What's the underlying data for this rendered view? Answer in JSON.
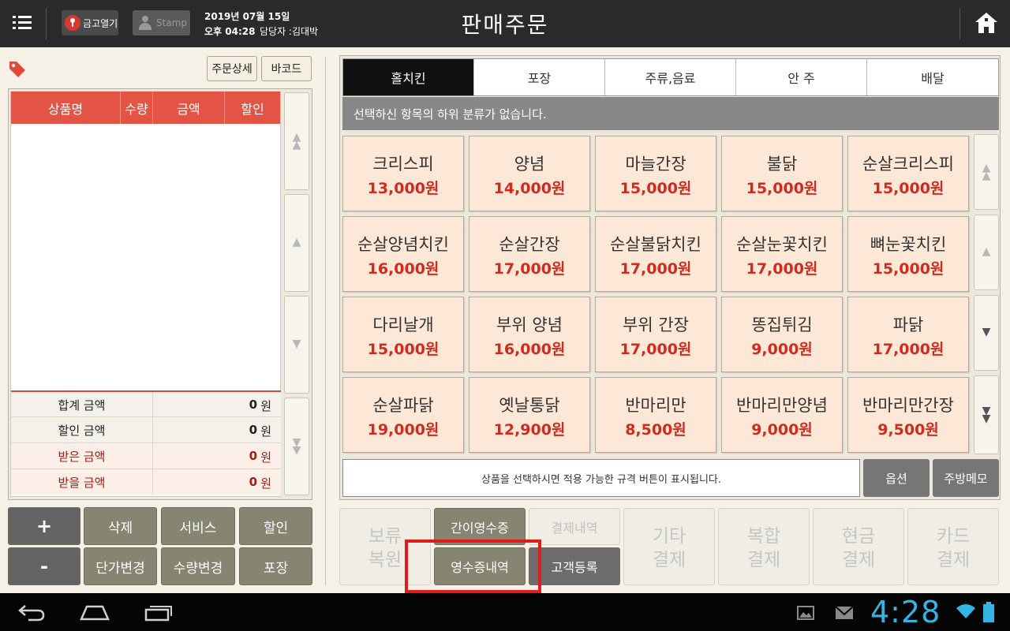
{
  "header": {
    "safe_label": "금고열기",
    "stamp_label": "Stamp",
    "date": "2019년 07월 15일",
    "time": "오후 04:28",
    "staff": "담당자 :김대박",
    "title": "판매주문"
  },
  "order_panel": {
    "detail_button": "주문상세",
    "barcode_button": "바코드",
    "columns": [
      "상품명",
      "수량",
      "금액",
      "할인"
    ],
    "summary": [
      {
        "label": "합계 금액",
        "value": "0",
        "unit": "원"
      },
      {
        "label": "할인 금액",
        "value": "0",
        "unit": "원"
      },
      {
        "label": "받은 금액",
        "value": "0",
        "unit": "원"
      },
      {
        "label": "받을 금액",
        "value": "0",
        "unit": "원"
      }
    ],
    "actions": [
      "+",
      "삭제",
      "서비스",
      "할인",
      "-",
      "단가변경",
      "수량변경",
      "포장"
    ]
  },
  "categories": {
    "tabs": [
      "홀치킨",
      "포장",
      "주류,음료",
      "안 주",
      "배달"
    ],
    "active_index": 0,
    "subcategory_message": "선택하신 항목의 하위 분류가 없습니다."
  },
  "products": [
    {
      "name": "크리스피",
      "price": "13,000원"
    },
    {
      "name": "양념",
      "price": "14,000원"
    },
    {
      "name": "마늘간장",
      "price": "15,000원"
    },
    {
      "name": "불닭",
      "price": "15,000원"
    },
    {
      "name": "순살크리스피",
      "price": "15,000원"
    },
    {
      "name": "순살양념치킨",
      "price": "16,000원"
    },
    {
      "name": "순살간장",
      "price": "17,000원"
    },
    {
      "name": "순살불닭치킨",
      "price": "17,000원"
    },
    {
      "name": "순살눈꽃치킨",
      "price": "17,000원"
    },
    {
      "name": "뼈눈꽃치킨",
      "price": "15,000원"
    },
    {
      "name": "다리날개",
      "price": "15,000원"
    },
    {
      "name": "부위 양념",
      "price": "16,000원"
    },
    {
      "name": "부위 간장",
      "price": "17,000원"
    },
    {
      "name": "똥집튀김",
      "price": "9,000원"
    },
    {
      "name": "파닭",
      "price": "17,000원"
    },
    {
      "name": "순살파닭",
      "price": "19,000원"
    },
    {
      "name": "옛날통닭",
      "price": "12,900원"
    },
    {
      "name": "반마리만",
      "price": "8,500원"
    },
    {
      "name": "반마리만양념",
      "price": "9,000원"
    },
    {
      "name": "반마리만간장",
      "price": "9,500원"
    }
  ],
  "spec_message": "상품을 선택하시면 적용 가능한 규격 버튼이 표시됩니다.",
  "option_button": "옵션",
  "kitchen_memo_button": "주방메모",
  "bottom": {
    "hold_restore": [
      "보류",
      "복원"
    ],
    "simple_receipt": "간이영수증",
    "payment_history": "결제내역",
    "receipt_history": "영수증내역",
    "customer_register": "고객등록",
    "other_payment": [
      "기타",
      "결제"
    ],
    "combined_payment": [
      "복합",
      "결제"
    ],
    "cash_payment": [
      "현금",
      "결제"
    ],
    "card_payment": [
      "카드",
      "결제"
    ]
  },
  "system": {
    "clock": "4:28"
  },
  "colors": {
    "topbar": "#2a2a2a",
    "table_header": "#e45445",
    "product_bg": "#fde7d6",
    "price": "#d12b1e",
    "action_button": "#858571",
    "highlight": "#e21b1b",
    "clock": "#32b5e5"
  }
}
